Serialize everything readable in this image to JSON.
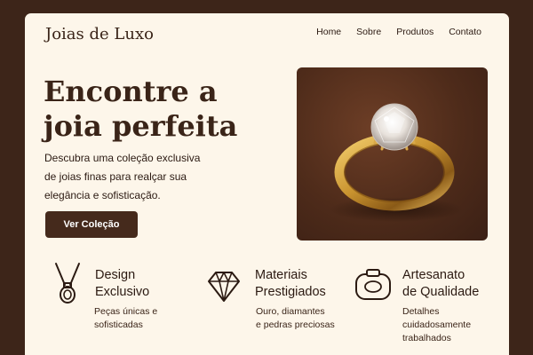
{
  "brand": "Joias de Luxo",
  "nav": [
    "Home",
    "Sobre",
    "Produtos",
    "Contato"
  ],
  "hero": {
    "title_line1": "Encontre a",
    "title_line2": "joia perfeita",
    "desc_line1": "Descubra uma coleção exclusiva",
    "desc_line2": "de joias finas para realçar sua",
    "desc_line3": "elegância e sofisticação.",
    "cta": "Ver Coleção",
    "image_icon": "gold-diamond-ring"
  },
  "features": [
    {
      "icon": "pendant-necklace-icon",
      "title_line1": "Design",
      "title_line2": "Exclusivo",
      "desc_lines": [
        "Peças únicas e",
        "sofisticadas"
      ]
    },
    {
      "icon": "diamond-icon",
      "title_line1": "Materiais",
      "title_line2": "Prestigiados",
      "desc_lines": [
        "Ouro, diamantes",
        "e pedras preciosas"
      ]
    },
    {
      "icon": "ring-box-icon",
      "title_line1": "Artesanato",
      "title_line2": "de Qualidade",
      "desc_lines": [
        "Detalhes",
        "cuidadosamente",
        "trabalhados"
      ]
    }
  ],
  "colors": {
    "background": "#3d2519",
    "card": "#fdf6ea",
    "primary": "#452a1c",
    "text": "#2b1a12",
    "gold": "#c9932f"
  }
}
